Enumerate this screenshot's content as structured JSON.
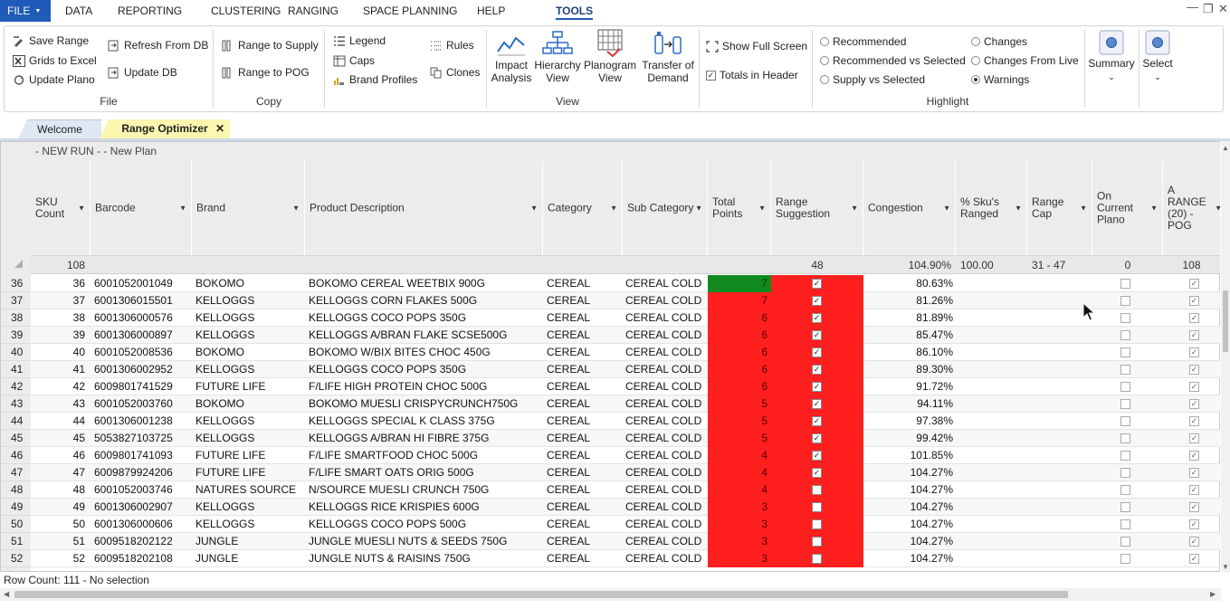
{
  "menu": {
    "file": "FILE",
    "items": [
      "DATA",
      "REPORTING",
      "CLUSTERING",
      "RANGING",
      "SPACE PLANNING",
      "HELP",
      "TOOLS"
    ],
    "active": "TOOLS"
  },
  "window_controls": {
    "minimize": "—",
    "restore": "❐",
    "close": "✕"
  },
  "ribbon": {
    "file_group": {
      "label": "File",
      "save_range": "Save Range",
      "grids_to_excel": "Grids to Excel",
      "update_plano": "Update Plano",
      "refresh_from_db": "Refresh From DB",
      "update_db": "Update DB"
    },
    "copy_group": {
      "label": "Copy",
      "range_to_supply": "Range to Supply",
      "range_to_pog": "Range to POG"
    },
    "view_group": {
      "label": "View",
      "legend": "Legend",
      "caps": "Caps",
      "brand_profiles": "Brand Profiles",
      "rules": "Rules",
      "clones": "Clones",
      "impact_analysis": [
        "Impact",
        "Analysis"
      ],
      "hierarchy_view": [
        "Hierarchy",
        "View"
      ],
      "planogram_view": [
        "Planogram",
        "View"
      ],
      "transfer_of_demand": [
        "Transfer of",
        "Demand"
      ],
      "show_full_screen": "Show Full Screen",
      "totals_in_header": "Totals in Header",
      "totals_in_header_checked": true
    },
    "highlight_group": {
      "label": "Highlight",
      "options": [
        "Recommended",
        "Recommended vs Selected",
        "Supply vs Selected",
        "Changes",
        "Changes From Live",
        "Warnings"
      ],
      "selected": "Warnings"
    },
    "summary": "Summary",
    "select": "Select"
  },
  "tabs": {
    "welcome": "Welcome",
    "range_optimizer": "Range Optimizer",
    "close": "✕"
  },
  "grid": {
    "plan_title": "- NEW RUN - - New Plan",
    "columns": [
      "SKU Count",
      "Barcode",
      "Brand",
      "Product Description",
      "Category",
      "Sub Category",
      "Total Points",
      "Range Suggestion",
      "Congestion",
      "% Sku's Ranged",
      "Range Cap",
      "On Current Plano",
      "A RANGE (20) - POG"
    ],
    "totals": {
      "sku_count": "108",
      "range_suggestion": "48",
      "congestion": "104.90%",
      "pct_ranged": "100.00",
      "range_cap": "31 - 47",
      "on_current_plano": "0",
      "a_range_pog": "108"
    },
    "rows": [
      {
        "rn": "36",
        "sku": "36",
        "barcode": "6001052001049",
        "brand": "BOKOMO",
        "desc": "BOKOMO CEREAL WEETBIX 900G",
        "cat": "CEREAL",
        "sub": "CEREAL COLD",
        "points": "7",
        "sugg": true,
        "cong": "80.63%",
        "plano": false,
        "pog": true
      },
      {
        "rn": "37",
        "sku": "37",
        "barcode": "6001306015501",
        "brand": "KELLOGGS",
        "desc": "KELLOGGS CORN FLAKES 500G",
        "cat": "CEREAL",
        "sub": "CEREAL COLD",
        "points": "7",
        "sugg": true,
        "cong": "81.26%",
        "plano": false,
        "pog": true
      },
      {
        "rn": "38",
        "sku": "38",
        "barcode": "6001306000576",
        "brand": "KELLOGGS",
        "desc": "KELLOGGS COCO POPS 350G",
        "cat": "CEREAL",
        "sub": "CEREAL COLD",
        "points": "6",
        "sugg": true,
        "cong": "81.89%",
        "plano": false,
        "pog": true
      },
      {
        "rn": "39",
        "sku": "39",
        "barcode": "6001306000897",
        "brand": "KELLOGGS",
        "desc": "KELLOGGS A/BRAN FLAKE SCSE500G",
        "cat": "CEREAL",
        "sub": "CEREAL COLD",
        "points": "6",
        "sugg": true,
        "cong": "85.47%",
        "plano": false,
        "pog": true
      },
      {
        "rn": "40",
        "sku": "40",
        "barcode": "6001052008536",
        "brand": "BOKOMO",
        "desc": "BOKOMO W/BIX BITES CHOC 450G",
        "cat": "CEREAL",
        "sub": "CEREAL COLD",
        "points": "6",
        "sugg": true,
        "cong": "86.10%",
        "plano": false,
        "pog": true
      },
      {
        "rn": "41",
        "sku": "41",
        "barcode": "6001306002952",
        "brand": "KELLOGGS",
        "desc": "KELLOGGS COCO POPS 350G",
        "cat": "CEREAL",
        "sub": "CEREAL COLD",
        "points": "6",
        "sugg": true,
        "cong": "89.30%",
        "plano": false,
        "pog": true
      },
      {
        "rn": "42",
        "sku": "42",
        "barcode": "6009801741529",
        "brand": "FUTURE LIFE",
        "desc": "F/LIFE HIGH PROTEIN CHOC 500G",
        "cat": "CEREAL",
        "sub": "CEREAL COLD",
        "points": "6",
        "sugg": true,
        "cong": "91.72%",
        "plano": false,
        "pog": true
      },
      {
        "rn": "43",
        "sku": "43",
        "barcode": "6001052003760",
        "brand": "BOKOMO",
        "desc": "BOKOMO MUESLI CRISPYCRUNCH750G",
        "cat": "CEREAL",
        "sub": "CEREAL COLD",
        "points": "5",
        "sugg": true,
        "cong": "94.11%",
        "plano": false,
        "pog": true
      },
      {
        "rn": "44",
        "sku": "44",
        "barcode": "6001306001238",
        "brand": "KELLOGGS",
        "desc": "KELLOGGS SPECIAL K CLASS 375G",
        "cat": "CEREAL",
        "sub": "CEREAL COLD",
        "points": "5",
        "sugg": true,
        "cong": "97.38%",
        "plano": false,
        "pog": true
      },
      {
        "rn": "45",
        "sku": "45",
        "barcode": "5053827103725",
        "brand": "KELLOGGS",
        "desc": "KELLOGGS A/BRAN HI FIBRE 375G",
        "cat": "CEREAL",
        "sub": "CEREAL COLD",
        "points": "5",
        "sugg": true,
        "cong": "99.42%",
        "plano": false,
        "pog": true
      },
      {
        "rn": "46",
        "sku": "46",
        "barcode": "6009801741093",
        "brand": "FUTURE LIFE",
        "desc": "F/LIFE SMARTFOOD CHOC 500G",
        "cat": "CEREAL",
        "sub": "CEREAL COLD",
        "points": "4",
        "sugg": true,
        "cong": "101.85%",
        "plano": false,
        "pog": true
      },
      {
        "rn": "47",
        "sku": "47",
        "barcode": "6009879924206",
        "brand": "FUTURE LIFE",
        "desc": "F/LIFE SMART OATS ORIG 500G",
        "cat": "CEREAL",
        "sub": "CEREAL COLD",
        "points": "4",
        "sugg": true,
        "cong": "104.27%",
        "plano": false,
        "pog": true
      },
      {
        "rn": "48",
        "sku": "48",
        "barcode": "6001052003746",
        "brand": "NATURES SOURCE",
        "desc": "N/SOURCE MUESLI CRUNCH 750G",
        "cat": "CEREAL",
        "sub": "CEREAL COLD",
        "points": "4",
        "sugg": false,
        "cong": "104.27%",
        "plano": false,
        "pog": true
      },
      {
        "rn": "49",
        "sku": "49",
        "barcode": "6001306002907",
        "brand": "KELLOGGS",
        "desc": "KELLOGGS RICE KRISPIES 600G",
        "cat": "CEREAL",
        "sub": "CEREAL COLD",
        "points": "3",
        "sugg": false,
        "cong": "104.27%",
        "plano": false,
        "pog": true
      },
      {
        "rn": "50",
        "sku": "50",
        "barcode": "6001306000606",
        "brand": "KELLOGGS",
        "desc": "KELLOGGS COCO POPS 500G",
        "cat": "CEREAL",
        "sub": "CEREAL COLD",
        "points": "3",
        "sugg": false,
        "cong": "104.27%",
        "plano": false,
        "pog": true
      },
      {
        "rn": "51",
        "sku": "51",
        "barcode": "6009518202122",
        "brand": "JUNGLE",
        "desc": "JUNGLE MUESLI NUTS & SEEDS 750G",
        "cat": "CEREAL",
        "sub": "CEREAL COLD",
        "points": "3",
        "sugg": false,
        "cong": "104.27%",
        "plano": false,
        "pog": true
      },
      {
        "rn": "52",
        "sku": "52",
        "barcode": "6009518202108",
        "brand": "JUNGLE",
        "desc": "JUNGLE NUTS & RAISINS 750G",
        "cat": "CEREAL",
        "sub": "CEREAL COLD",
        "points": "3",
        "sugg": false,
        "cong": "104.27%",
        "plano": false,
        "pog": true
      }
    ],
    "status": "Row Count: 111 - No selection"
  },
  "colors": {
    "file_blue": "#1f5bb8",
    "warning_red": "#ff1f1f",
    "ok_green": "#108a1e",
    "tab_yellow": "#fbf6b0"
  },
  "icons": [
    "save-icon",
    "excel-icon",
    "update-icon",
    "refresh-icon",
    "legend-icon",
    "caps-icon",
    "brand-profiles-icon",
    "rules-icon",
    "clones-icon",
    "impact-analysis-icon",
    "hierarchy-icon",
    "planogram-icon",
    "transfer-icon",
    "full-screen-icon",
    "summary-icon",
    "select-icon",
    "mouse-cursor-icon"
  ]
}
